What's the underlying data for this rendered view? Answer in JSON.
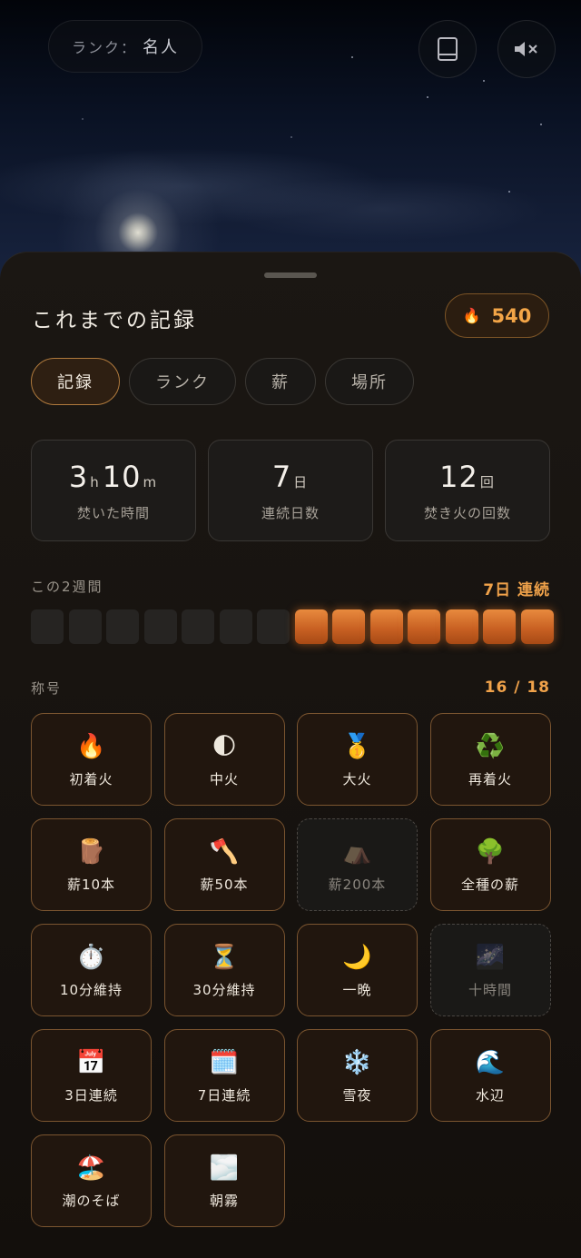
{
  "header": {
    "rank_label": "ランク：",
    "rank_value": "名人",
    "book_icon": "book-icon",
    "mute_icon": "speaker-mute-icon"
  },
  "sheet": {
    "title": "これまでの記録",
    "wood_icon": "fire-icon",
    "wood_count": "540",
    "tabs": [
      {
        "label": "記録",
        "active": true
      },
      {
        "label": "ランク",
        "active": false
      },
      {
        "label": "薪",
        "active": false
      },
      {
        "label": "場所",
        "active": false
      }
    ],
    "stats": [
      {
        "parts": [
          {
            "num": "3",
            "unit": "h"
          },
          {
            "num": "10",
            "unit": "m"
          }
        ],
        "label": "焚いた時間"
      },
      {
        "parts": [
          {
            "num": "7",
            "unit": "日"
          }
        ],
        "label": "連続日数"
      },
      {
        "parts": [
          {
            "num": "12",
            "unit": "回"
          }
        ],
        "label": "焚き火の回数"
      }
    ],
    "two_weeks": {
      "label": "この2週間",
      "streak": "7日 連続",
      "days": [
        false,
        false,
        false,
        false,
        false,
        false,
        false,
        true,
        true,
        true,
        true,
        true,
        true,
        true
      ]
    },
    "titles": {
      "label": "称号",
      "count": "16 / 18",
      "items": [
        {
          "icon": "🔥",
          "icon_name": "fire-icon",
          "name": "初着火",
          "unlocked": true
        },
        {
          "icon": "🌓",
          "icon_name": "half-moon-icon",
          "name": "中火",
          "unlocked": true
        },
        {
          "icon": "🥇",
          "icon_name": "gold-medal-icon",
          "name": "大火",
          "unlocked": true
        },
        {
          "icon": "♻️",
          "icon_name": "recycle-icon",
          "name": "再着火",
          "unlocked": true
        },
        {
          "icon": "🪵",
          "icon_name": "wood-log-icon",
          "name": "薪10本",
          "unlocked": true
        },
        {
          "icon": "🪓",
          "icon_name": "axe-icon",
          "name": "薪50本",
          "unlocked": true
        },
        {
          "icon": "⛺",
          "icon_name": "tent-icon",
          "name": "薪200本",
          "unlocked": false
        },
        {
          "icon": "🌳",
          "icon_name": "tree-icon",
          "name": "全種の薪",
          "unlocked": true
        },
        {
          "icon": "⏱️",
          "icon_name": "stopwatch-icon",
          "name": "10分維持",
          "unlocked": true
        },
        {
          "icon": "⏳",
          "icon_name": "hourglass-icon",
          "name": "30分維持",
          "unlocked": true
        },
        {
          "icon": "🌙",
          "icon_name": "crescent-moon-icon",
          "name": "一晩",
          "unlocked": true
        },
        {
          "icon": "🌌",
          "icon_name": "milky-way-icon",
          "name": "十時間",
          "unlocked": false
        },
        {
          "icon": "📅",
          "icon_name": "calendar-icon",
          "name": "3日連続",
          "unlocked": true
        },
        {
          "icon": "🗓️",
          "icon_name": "spiral-calendar-icon",
          "name": "7日連続",
          "unlocked": true
        },
        {
          "icon": "❄️",
          "icon_name": "snowflake-icon",
          "name": "雪夜",
          "unlocked": true
        },
        {
          "icon": "🌊",
          "icon_name": "wave-icon",
          "name": "水辺",
          "unlocked": true
        },
        {
          "icon": "🏖️",
          "icon_name": "beach-icon",
          "name": "潮のそば",
          "unlocked": true
        },
        {
          "icon": "🌫️",
          "icon_name": "fog-icon",
          "name": "朝霧",
          "unlocked": true
        }
      ]
    }
  },
  "colors": {
    "accent": "#f0a24a",
    "streak_on": "#d26a28",
    "badge_border": "#7b5530"
  }
}
